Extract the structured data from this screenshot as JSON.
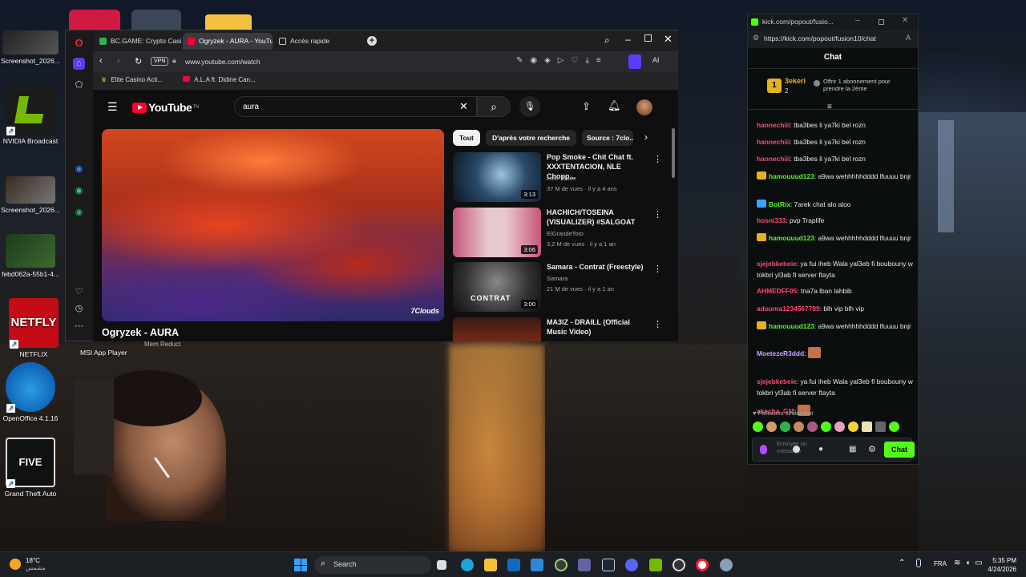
{
  "desktop": {
    "icons": [
      {
        "label": "Screenshot_2026..."
      },
      {
        "label": "NVIDIA Broadcast"
      },
      {
        "label": "Screenshot_2026..."
      },
      {
        "label": "febd062a-55b1-4..."
      },
      {
        "label": "NETFLIX"
      },
      {
        "label": "OpenOffice 4.1.16"
      },
      {
        "label": "Grand Theft Auto"
      }
    ],
    "netflix_tile_text": "NETFLY",
    "gta_tile_text": "FIVE",
    "msi_label": "MSI App Player",
    "memreduct_label": "Mem Reduct"
  },
  "browser": {
    "tabs": [
      {
        "label": "BC.GAME: Crypto Casino G..."
      },
      {
        "label": "Ogryzek - AURA - YouTube"
      },
      {
        "label": "Accès rapide"
      }
    ],
    "vpn": "VPN",
    "url": "www.youtube.com/watch",
    "ai": "AI",
    "bookmarks": [
      {
        "label": "Elite Casino Acti..."
      },
      {
        "label": "A.L.A ft. Didine Can..."
      }
    ],
    "colors": {
      "opera": "#ff1b2d",
      "accent": "#5b3cff"
    }
  },
  "youtube": {
    "logo_text": "YouTube",
    "logo_sup": "TN",
    "search_value": "aura",
    "video_title": "Ogryzek - AURA",
    "watermark": "7Clouds",
    "chips": [
      "Tout",
      "D'après votre recherche",
      "Source : 7clo..."
    ],
    "related": [
      {
        "title": "Pop Smoke - Chit Chat ft. XXXTENTACION, NLE Chopp...",
        "channel": "Last- Dude",
        "meta": "37 M de vues · il y a 4 ans",
        "duration": "3:13"
      },
      {
        "title": "HACHICH/TOSEINA (VISUALIZER) #SALGOAT",
        "channel": "ElGrandeToto",
        "meta": "3,2 M de vues · il y a 1 an",
        "duration": "3:06"
      },
      {
        "title": "Samara - Contrat (Freestyle)",
        "channel": "Samara",
        "meta": "21 M de vues · il y a 1 an",
        "duration": "3:00",
        "thumb_text": "CONTRAT"
      },
      {
        "title": "MA3IZ - DRAILL (Official Music Video)",
        "channel": "",
        "meta": "",
        "duration": ""
      }
    ],
    "colors": {
      "red": "#ff0033"
    }
  },
  "chat": {
    "window_url_title": "kick.com/popout/fusio...",
    "address": "https://kick.com/popout/fusion10/chat",
    "header": "Chat",
    "top_gifter": {
      "rank": "1",
      "name": "3ekeri",
      "count": "2"
    },
    "sub_offer": "Offrir 1 abonnement pour prendre la 2ème",
    "messages": [
      {
        "user": "hannechiii",
        "text": "tba3bes li ya7ki bel rozn",
        "color": "#ff4a6d"
      },
      {
        "user": "hannechiii",
        "text": "tba3bes li ya7ki bel rozn",
        "color": "#ff4a6d"
      },
      {
        "user": "hannechiii",
        "text": "tba3bes li ya7ki bel rozn",
        "color": "#ff4a6d"
      },
      {
        "user": "hamouuud123",
        "text": "a9wa wehhhhhdddd lfuuuu bnjr",
        "color": "#53fc18"
      },
      {
        "user": "BotRix",
        "text": "7arek chat alo aloo",
        "color": "#53fc18"
      },
      {
        "user": "hosni333",
        "text": "pvp Traplife",
        "color": "#ff4a6d"
      },
      {
        "user": "hamouuud123",
        "text": "a9wa wehhhhhdddd lfuuuu bnjr",
        "color": "#53fc18"
      },
      {
        "user": "sjejebkebeie",
        "text": "ya fui iheb Wala yal3eb fi boubouny w tokbri yl3ab fi server ftayta",
        "color": "#ff4a6d"
      },
      {
        "user": "AHMEDFF05",
        "text": "tna7a lban lahbib",
        "color": "#ff4a6d"
      },
      {
        "user": "adouma1234567789",
        "text": "blh vip blh vip",
        "color": "#ff4a6d"
      },
      {
        "user": "hamouuud123",
        "text": "a9wa wehhhhhdddd lfuuuu bnjr",
        "color": "#53fc18"
      },
      {
        "user": "MoetezeR3ddd",
        "text": "",
        "color": "#c7a6ff"
      },
      {
        "user": "sjejebkebeie",
        "text": "ya fui iheb Wala yal3eb fi boubouny w tokbri yl3ab fi server ftayta",
        "color": "#ff4a6d"
      },
      {
        "user": "akecha_GM",
        "text": "",
        "color": "#ff4a6d"
      }
    ],
    "followers_only": "Followers seulement",
    "input_placeholder": "Envoyer un message",
    "send_label": "Chat",
    "colors": {
      "kick_green": "#53fc18"
    }
  },
  "taskbar": {
    "weather_temp": "18°C",
    "weather_desc": "مشمس",
    "search_placeholder": "Search",
    "lang": "FRA",
    "time": "5:35 PM",
    "date": "4/24/2026"
  }
}
